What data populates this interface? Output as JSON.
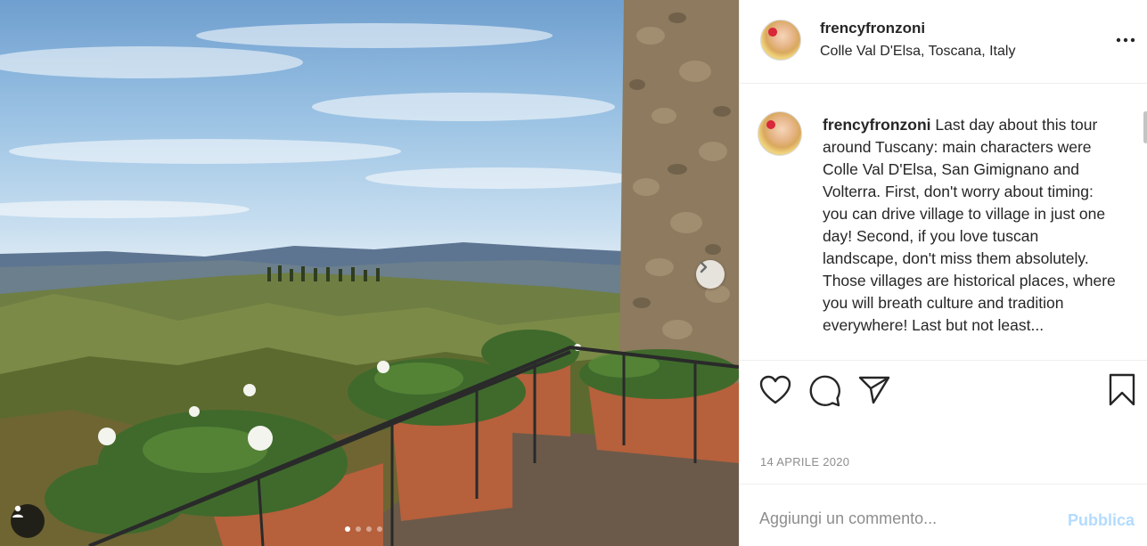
{
  "post": {
    "username": "frencyfronzoni",
    "location": "Colle Val D'Elsa, Toscana, Italy",
    "caption": "Last day about this tour around Tuscany: main characters were Colle Val D'Elsa, San Gimignano and Volterra. First, don't worry about timing: you can drive village to village in just one day! Second, if you love tuscan landscape, don't miss them absolutely. Those villages are historical places, where you will breath culture and tradition everywhere! Last but not least...",
    "date": "14 APRILE 2020"
  },
  "carousel": {
    "slide_count": 4,
    "active_index": 0
  },
  "comment": {
    "placeholder": "Aggiungi un commento...",
    "publish_label": "Pubblica"
  },
  "icons": {
    "more": "more-horizontal-icon",
    "like": "heart-icon",
    "comment": "comment-bubble-icon",
    "share": "paper-plane-icon",
    "save": "bookmark-icon",
    "next": "chevron-right-icon",
    "user_tag": "person-icon"
  },
  "colors": {
    "text": "#262626",
    "muted": "#8e8e8e",
    "publish_disabled": "#b3dbff",
    "divider": "#efefef"
  }
}
